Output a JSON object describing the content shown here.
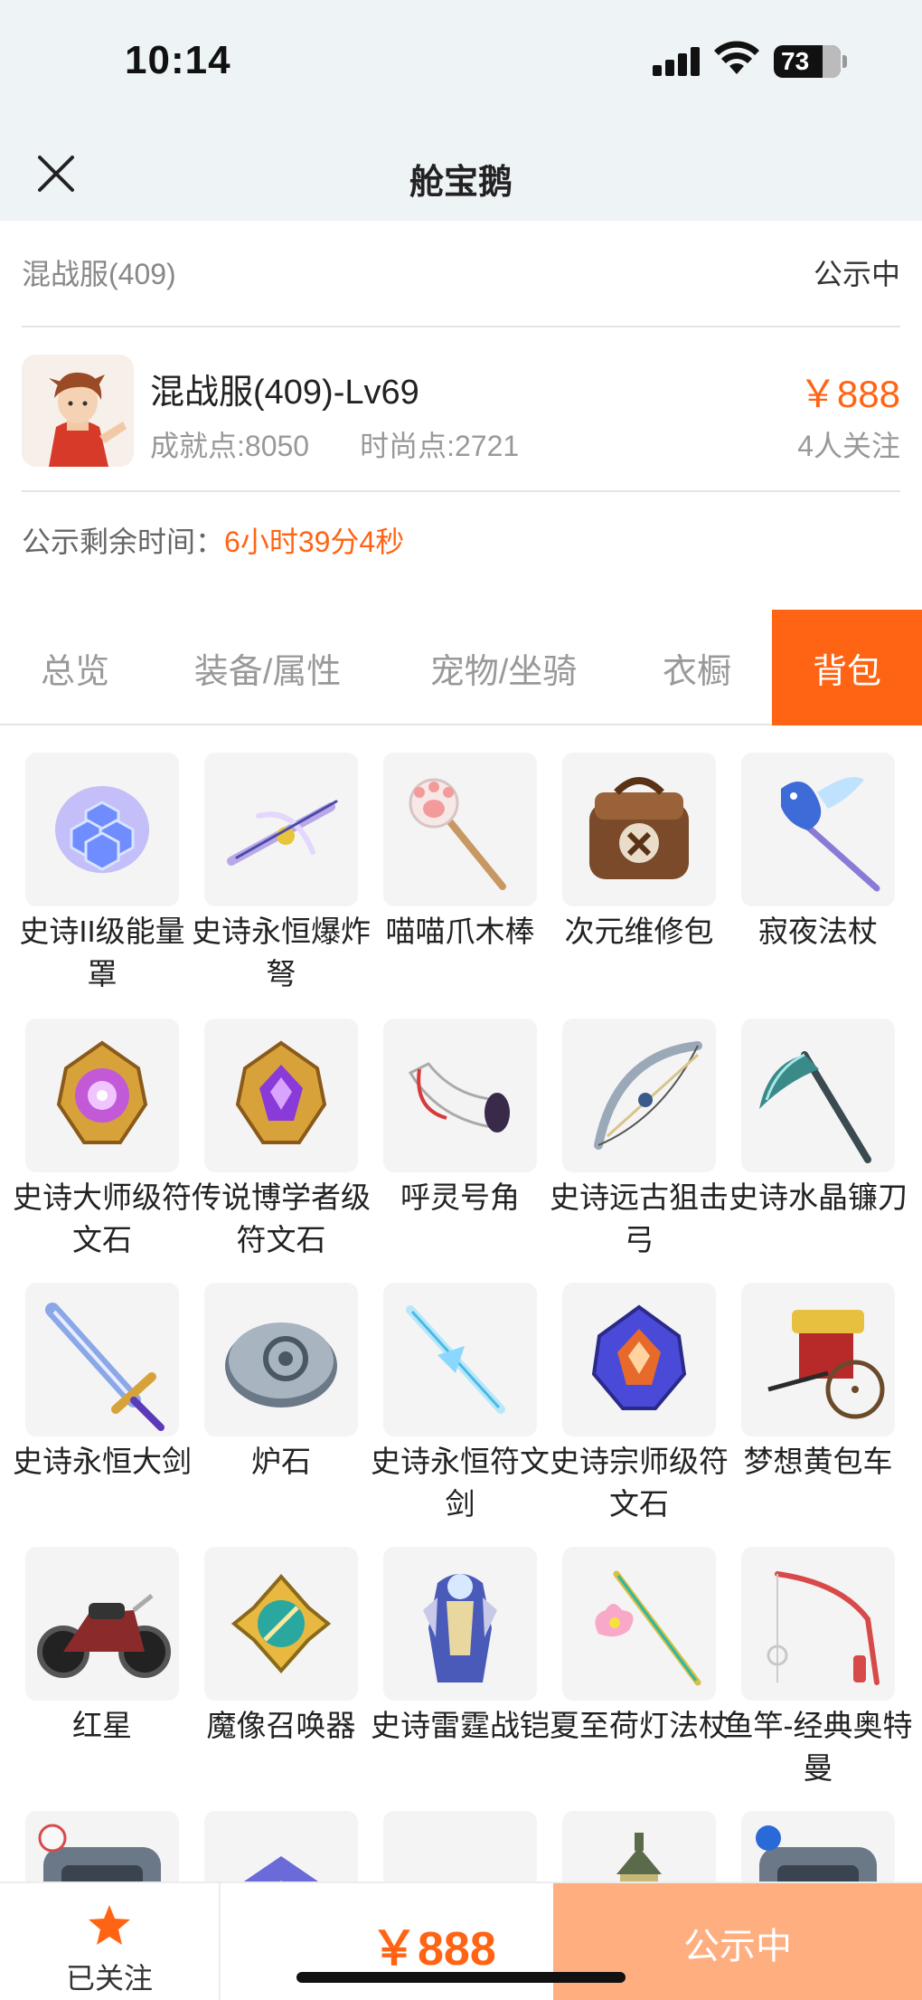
{
  "status_bar": {
    "time": "10:14",
    "battery": "73",
    "battery_level": 0.73
  },
  "nav": {
    "title": "舱宝鹅"
  },
  "server": {
    "name": "混战服(409)",
    "status": "公示中"
  },
  "account": {
    "title": "混战服(409)-Lv69",
    "achievement": "成就点:8050",
    "fashion": "时尚点:2721",
    "price": "￥888",
    "followers": "4人关注"
  },
  "timer": {
    "label": "公示剩余时间：",
    "value": "6小时39分4秒"
  },
  "tabs": [
    {
      "label": "总览"
    },
    {
      "label": "装备/属性"
    },
    {
      "label": "宠物/坐骑"
    },
    {
      "label": "衣橱"
    },
    {
      "label": "背包",
      "active": true
    }
  ],
  "items": [
    {
      "name": "史诗II级能量罩",
      "icon": "energy-shield-icon"
    },
    {
      "name": "史诗永恒爆炸弩",
      "icon": "crossbow-icon"
    },
    {
      "name": "喵喵爪木棒",
      "icon": "paw-staff-icon"
    },
    {
      "name": "次元维修包",
      "icon": "repair-bag-icon"
    },
    {
      "name": "寂夜法杖",
      "icon": "pegasus-staff-icon"
    },
    {
      "name": "史诗大师级符文石",
      "icon": "rune-stone-icon"
    },
    {
      "name": "传说博学者级符文石",
      "icon": "rune-stone-purple-icon"
    },
    {
      "name": "呼灵号角",
      "icon": "horn-icon"
    },
    {
      "name": "史诗远古狙击弓",
      "icon": "bow-icon"
    },
    {
      "name": "史诗水晶镰刀",
      "icon": "scythe-icon"
    },
    {
      "name": "史诗永恒大剑",
      "icon": "greatsword-icon"
    },
    {
      "name": "炉石",
      "icon": "hearthstone-icon"
    },
    {
      "name": "史诗永恒符文剑",
      "icon": "rune-sword-icon"
    },
    {
      "name": "史诗宗师级符文石",
      "icon": "rune-stone-red-icon"
    },
    {
      "name": "梦想黄包车",
      "icon": "rickshaw-icon"
    },
    {
      "name": "红星",
      "icon": "motorcycle-icon"
    },
    {
      "name": "魔像召唤器",
      "icon": "golem-summoner-icon"
    },
    {
      "name": "史诗雷霆战铠",
      "icon": "armor-icon"
    },
    {
      "name": "夏至荷灯法杖",
      "icon": "lotus-staff-icon"
    },
    {
      "name": "鱼竿-经典奥特曼",
      "icon": "fishing-rod-icon"
    },
    {
      "name": "",
      "icon": "pet-cage-icon"
    },
    {
      "name": "",
      "icon": "emblem-icon"
    },
    {
      "name": "",
      "icon": "orb-icon"
    },
    {
      "name": "",
      "icon": "lantern-icon"
    },
    {
      "name": "",
      "icon": "cage-icon"
    }
  ],
  "bottom": {
    "follow_label": "已关注",
    "price": "￥888",
    "action": "公示中"
  },
  "colors": {
    "accent": "#ff6414",
    "action_bg": "#ffae7f",
    "header_bg": "#eef3f6"
  }
}
